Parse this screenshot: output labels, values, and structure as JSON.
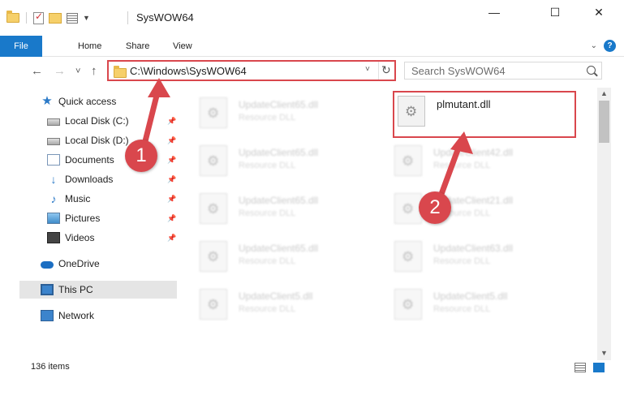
{
  "window": {
    "title": "SysWOW64",
    "minimize": "—",
    "maximize": "☐",
    "close": "✕"
  },
  "ribbon": {
    "tabs": [
      "File",
      "Home",
      "Share",
      "View"
    ],
    "expand_icon": "chevron-down-icon",
    "help_label": "?"
  },
  "nav": {
    "back": "←",
    "forward": "→",
    "recent": "˅",
    "up": "↑",
    "address": "C:\\Windows\\SysWOW64",
    "address_dropdown": "˅",
    "refresh": "↻",
    "search_placeholder": "Search SysWOW64"
  },
  "sidebar": {
    "items": [
      {
        "label": "Quick access",
        "icon": "star-icon",
        "pinned": false
      },
      {
        "label": "Local Disk (C:)",
        "icon": "disk-icon",
        "pinned": true
      },
      {
        "label": "Local Disk (D:)",
        "icon": "disk-icon",
        "pinned": true
      },
      {
        "label": "Documents",
        "icon": "documents-icon",
        "pinned": true
      },
      {
        "label": "Downloads",
        "icon": "download-icon",
        "pinned": true
      },
      {
        "label": "Music",
        "icon": "music-icon",
        "pinned": true
      },
      {
        "label": "Pictures",
        "icon": "pictures-icon",
        "pinned": true
      },
      {
        "label": "Videos",
        "icon": "videos-icon",
        "pinned": true
      },
      {
        "label": "OneDrive",
        "icon": "cloud-icon",
        "pinned": false
      },
      {
        "label": "This PC",
        "icon": "computer-icon",
        "pinned": false,
        "selected": true
      },
      {
        "label": "Network",
        "icon": "network-icon",
        "pinned": false
      }
    ],
    "pin_glyph": "📌"
  },
  "files": {
    "left_column": [
      {
        "name": "UpdateClient65.dll",
        "type": "Resource DLL"
      },
      {
        "name": "UpdateClient65.dll",
        "type": "Resource DLL"
      },
      {
        "name": "UpdateClient65.dll",
        "type": "Resource DLL"
      },
      {
        "name": "UpdateClient65.dll",
        "type": "Resource DLL"
      },
      {
        "name": "UpdateClient5.dll",
        "type": "Resource DLL"
      }
    ],
    "right_column": [
      {
        "name": "plmutant.dll",
        "type": ""
      },
      {
        "name": "UpdateClient42.dll",
        "type": "Resource DLL"
      },
      {
        "name": "UpdateClient21.dll",
        "type": "Resource DLL"
      },
      {
        "name": "UpdateClient63.dll",
        "type": "Resource DLL"
      },
      {
        "name": "UpdateClient5.dll",
        "type": "Resource DLL"
      }
    ]
  },
  "status": {
    "item_count": "136 items"
  },
  "callouts": [
    {
      "number": "1",
      "color": "#d9474d"
    },
    {
      "number": "2",
      "color": "#d9474d"
    }
  ],
  "colors": {
    "accent": "#1979ca",
    "highlight": "#d9474d",
    "selected_bg": "#e5e5e5"
  }
}
